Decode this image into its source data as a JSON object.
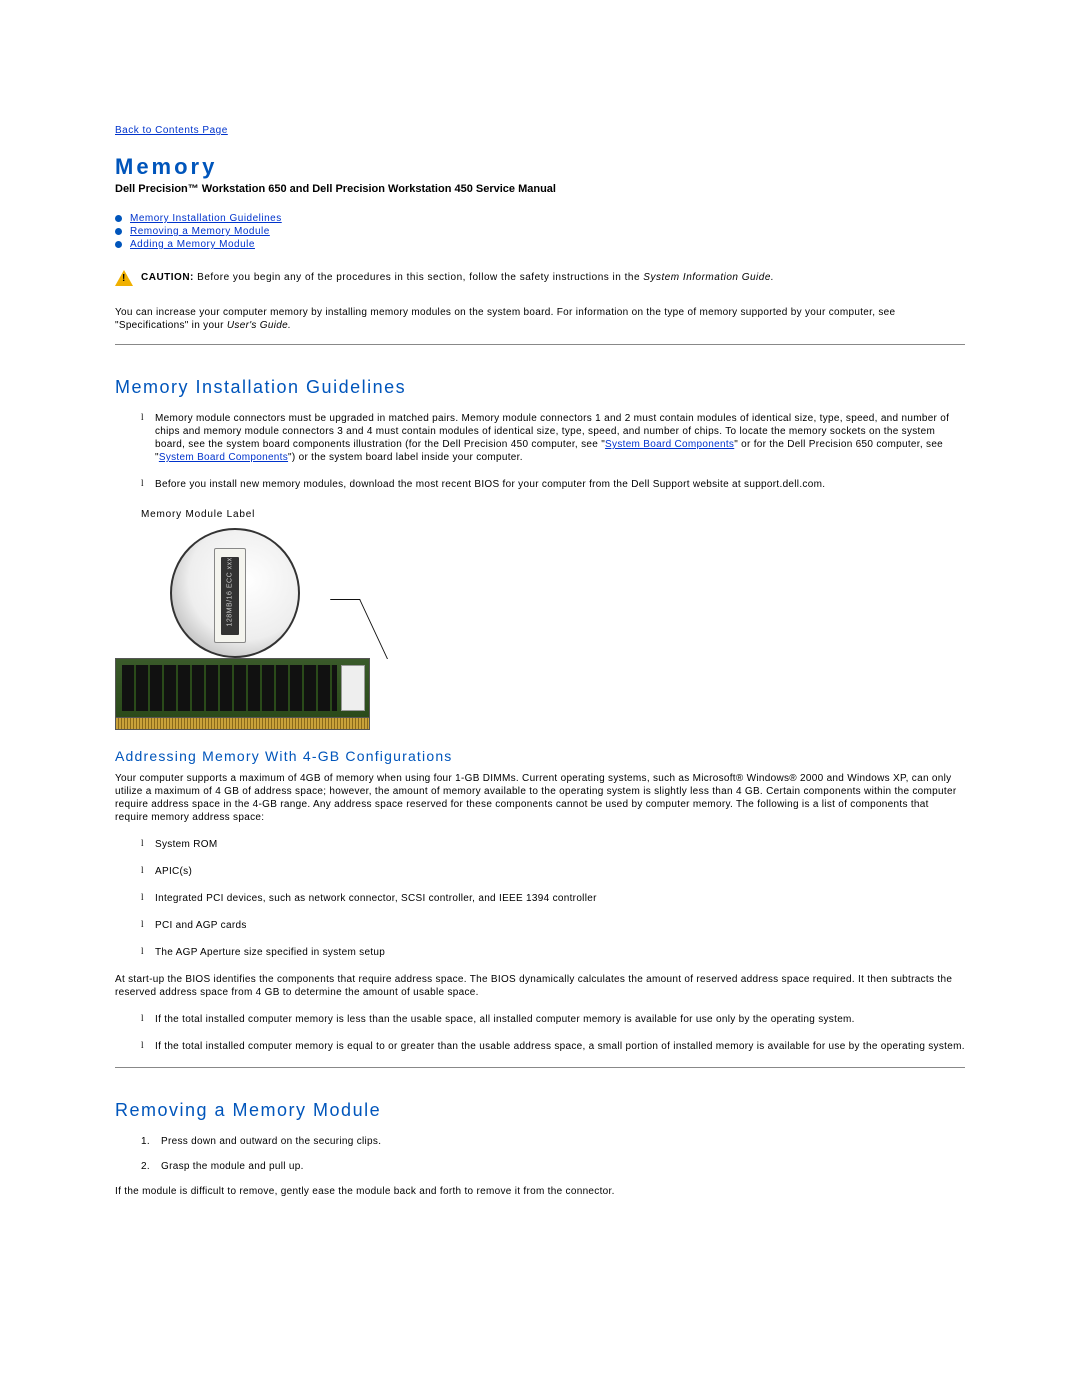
{
  "back_link": "Back to Contents Page",
  "page_title": "Memory",
  "subtitle": "Dell Precision™ Workstation 650 and Dell Precision Workstation 450 Service Manual",
  "toc": [
    "Memory Installation Guidelines",
    "Removing a Memory Module",
    "Adding a Memory Module"
  ],
  "caution": {
    "label": "CAUTION:",
    "text": "Before you begin any of the procedures in this section, follow the safety instructions in the",
    "italic": "System Information Guide."
  },
  "intro": {
    "text": "You can increase your computer memory by installing memory modules on the system board. For information on the type of memory supported by your computer, see \"Specifications\" in your",
    "italic": "User's Guide."
  },
  "section1": {
    "heading": "Memory Installation Guidelines",
    "items": [
      {
        "pre": "Memory module connectors must be upgraded in matched pairs. Memory module connectors 1 and 2 must contain modules of identical size, type, speed, and number of chips and memory module connectors 3 and 4 must contain modules of identical size, type, speed, and number of chips. To locate the memory sockets on the system board, see the system board components illustration (for the Dell Precision 450 computer, see \"",
        "link1": "System Board Components",
        "mid": "\" or for the Dell Precision 650 computer, see \"",
        "link2": "System Board Components",
        "post": "\") or the system board label inside your computer."
      },
      {
        "text": "Before you install new memory modules, download the most recent BIOS for your computer from the Dell Support website at support.dell.com."
      }
    ],
    "label_caption": "Memory Module Label",
    "chip_label": "128MB/16 ECC xxx"
  },
  "section2": {
    "heading": "Addressing Memory With 4-GB Configurations",
    "para": "Your computer supports a maximum of 4GB of memory when using four 1-GB DIMMs. Current operating systems, such as Microsoft® Windows® 2000 and Windows XP, can only utilize a maximum of 4 GB of address space; however, the amount of memory available to the operating system is slightly less than 4 GB. Certain components within the computer require address space in the 4-GB range. Any address space reserved for these components cannot be used by computer memory. The following is a list of components that require memory address space:",
    "list": [
      "System ROM",
      "APIC(s)",
      "Integrated PCI devices, such as network connector, SCSI controller, and IEEE 1394 controller",
      "PCI and AGP cards",
      "The AGP Aperture size specified in system setup"
    ],
    "para2": "At start-up the BIOS identifies the components that require address space. The BIOS dynamically calculates the amount of reserved address space required. It then subtracts the reserved address space from 4 GB to determine the amount of usable space.",
    "list2": [
      "If the total installed computer memory is less than the usable space, all installed computer memory is available for use only by the operating system.",
      "If the total installed computer memory is equal to or greater than the usable address space, a small portion of installed memory is available for use by the operating system."
    ]
  },
  "section3": {
    "heading": "Removing a Memory Module",
    "steps": [
      "Press down and outward on the securing clips.",
      "Grasp the module and pull up."
    ],
    "after": "If the module is difficult to remove, gently ease the module back and forth to remove it from the connector."
  }
}
